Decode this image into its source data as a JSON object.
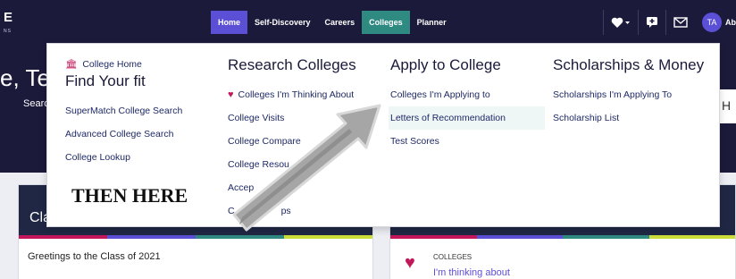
{
  "topbar": {
    "logo": "E",
    "logo_sub": "NS",
    "nav": [
      {
        "label": "Home"
      },
      {
        "label": "Self-Discovery"
      },
      {
        "label": "Careers"
      },
      {
        "label": "Colleges"
      },
      {
        "label": "Planner"
      }
    ],
    "avatar_initials": "TA",
    "user_abbr": "Abc",
    "icons": [
      "heart-dropdown-icon",
      "chat-icon",
      "mail-icon"
    ]
  },
  "background": {
    "greeting": "e, Te",
    "search_label": "Searc",
    "right_fragment": "H",
    "class_card_title": "Cla",
    "class_card_text": "Greetings to the Class of 2021",
    "colleges_label": "COLLEGES",
    "colleges_sub": "I'm thinking about"
  },
  "mega": {
    "col1": {
      "home_link": "College Home",
      "heading": "Find Your fit",
      "links": [
        "SuperMatch College Search",
        "Advanced College Search",
        "College Lookup"
      ]
    },
    "col2": {
      "heading": "Research Colleges",
      "links": [
        "Colleges I'm Thinking About",
        "College Visits",
        "College Compare",
        "College Resou",
        "Accep",
        "C"
      ],
      "tail": "ps"
    },
    "col3": {
      "heading": "Apply to College",
      "links": [
        "Colleges I'm Applying to",
        "Letters of Recommendation",
        "Test Scores"
      ]
    },
    "col4": {
      "heading": "Scholarships & Money",
      "links": [
        "Scholarships I'm Applying To",
        "Scholarship List"
      ]
    }
  },
  "annotation": {
    "text": "THEN HERE"
  },
  "colors": {
    "navy": "#1b1a3a",
    "home_tab": "#5b4fd6",
    "colleges_tab": "#2f8a82",
    "heart": "#c2185b",
    "link": "#1f2a66",
    "stripes": [
      "#c2185b",
      "#5b4fd6",
      "#2f8a82",
      "#cddc39"
    ]
  }
}
